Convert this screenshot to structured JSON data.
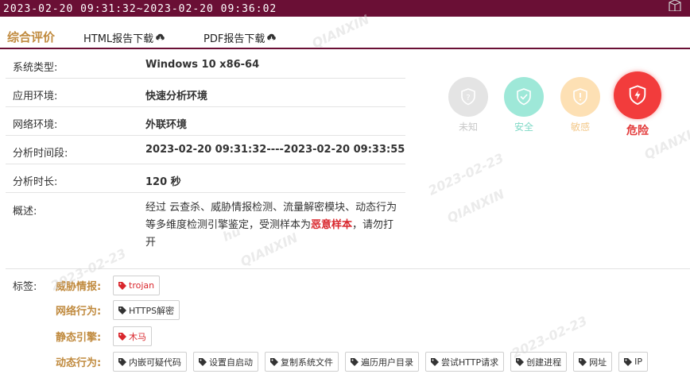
{
  "header": {
    "time_range": "2023-02-20 09:31:32~2023-02-20 09:36:02",
    "corner_icon": "cube-icon"
  },
  "tabs": {
    "summary": "综合评价",
    "html_download": "HTML报告下载",
    "pdf_download": "PDF报告下载",
    "download_icon": "cloud-download-icon"
  },
  "info": [
    {
      "label": "系统类型:",
      "value": "Windows 10 x86-64"
    },
    {
      "label": "应用环境:",
      "value": "快速分析环境"
    },
    {
      "label": "网络环境:",
      "value": "外联环境"
    },
    {
      "label": "分析时间段:",
      "value": "2023-02-20 09:31:32----2023-02-20 09:33:55"
    },
    {
      "label": "分析时长:",
      "value": "120 秒"
    }
  ],
  "summary": {
    "label": "概述:",
    "text_before": "经过 云查杀、威胁情报检测、流量解密模块、动态行为 等多维度检测引擎鉴定，受测样本为",
    "verdict": "恶意样本",
    "text_after": "，请勿打开"
  },
  "levels": [
    {
      "name": "未知",
      "color": "#dcdcdc",
      "text_color": "#c8c8c8",
      "icon": "question-shield-icon"
    },
    {
      "name": "安全",
      "color": "#9ee8d8",
      "text_color": "#7fd9c6",
      "icon": "check-shield-icon"
    },
    {
      "name": "敏感",
      "color": "#fde0b4",
      "text_color": "#f3c98b",
      "icon": "exclaim-shield-icon"
    },
    {
      "name": "危险",
      "color": "#f23c3c",
      "text_color": "#e33a3a",
      "icon": "lightning-shield-icon",
      "active": true
    }
  ],
  "tags": {
    "label": "标签:",
    "rows": [
      {
        "category": "威胁情报:",
        "items": [
          {
            "text": "trojan",
            "red": true
          }
        ]
      },
      {
        "category": "网络行为:",
        "items": [
          {
            "text": "HTTPS解密",
            "red": false
          }
        ]
      },
      {
        "category": "静态引擎:",
        "items": [
          {
            "text": "木马",
            "red": true
          }
        ]
      },
      {
        "category": "动态行为:",
        "items": [
          {
            "text": "内嵌可疑代码",
            "red": false
          },
          {
            "text": "设置自启动",
            "red": false
          },
          {
            "text": "复制系统文件",
            "red": false
          },
          {
            "text": "遍历用户目录",
            "red": false
          },
          {
            "text": "尝试HTTP请求",
            "red": false
          },
          {
            "text": "创建进程",
            "red": false
          },
          {
            "text": "网址",
            "red": false
          },
          {
            "text": "IP",
            "red": false
          }
        ]
      }
    ],
    "tag_icon": "tag-icon"
  },
  "colors": {
    "brand": "#6a0f35",
    "accent": "#c08a3e",
    "danger": "#d9262c"
  },
  "watermark": {
    "date": "2023-02-23",
    "user": "hu",
    "brand": "QIANXIN"
  }
}
